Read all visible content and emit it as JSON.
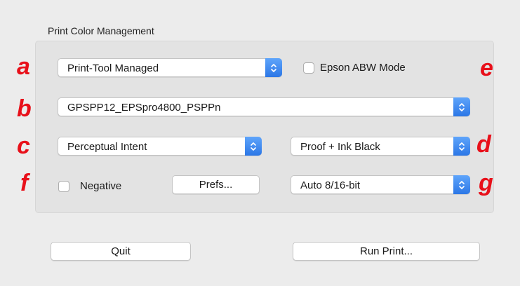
{
  "group": {
    "title": "Print Color Management"
  },
  "letters": {
    "a": "a",
    "b": "b",
    "c": "c",
    "d": "d",
    "e": "e",
    "f": "f",
    "g": "g"
  },
  "color_management_popup": {
    "value": "Print-Tool Managed"
  },
  "epson_abw": {
    "label": "Epson ABW Mode",
    "checked": false
  },
  "profile_popup": {
    "value": "GPSPP12_EPSpro4800_PSPPn"
  },
  "intent_popup": {
    "value": "Perceptual Intent"
  },
  "proof_popup": {
    "value": "Proof + Ink Black"
  },
  "negative": {
    "label": "Negative",
    "checked": false
  },
  "prefs_button": {
    "label": "Prefs..."
  },
  "bitdepth_popup": {
    "value": "Auto 8/16-bit"
  },
  "quit_button": {
    "label": "Quit"
  },
  "run_print_button": {
    "label": "Run Print..."
  },
  "colors": {
    "accent": "#2c77e6",
    "annotation": "#e8101a",
    "background": "#ececec"
  }
}
